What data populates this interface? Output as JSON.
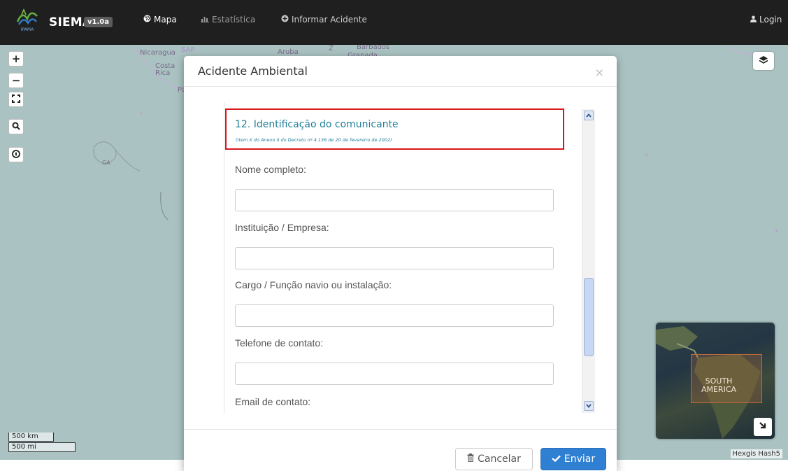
{
  "navbar": {
    "brand_name": "SIEMA",
    "brand_version": "v1.0a",
    "logo_text": "IPAMA",
    "items": [
      {
        "label": "Mapa",
        "icon": "globe-icon"
      },
      {
        "label": "Estatística",
        "icon": "bar-chart-icon"
      },
      {
        "label": "Informar Acidente",
        "icon": "plus-circle-icon"
      }
    ],
    "login_label": "Login",
    "login_icon": "user-icon"
  },
  "map": {
    "labels": {
      "nicaragua": "Nicaragua",
      "sap": "SAP",
      "costa_rica": "Costa\nRica",
      "pa": "Pa",
      "aruba": "Aruba",
      "z": "Z",
      "barbados": "Barbados",
      "granada": "Granada",
      "ga": "GA"
    },
    "controls": [
      "zoom-in",
      "zoom-out",
      "fullscreen",
      "search",
      "locate"
    ],
    "zoom_in": "+",
    "zoom_out": "−",
    "scale": {
      "km": "500 km",
      "mi": "500 mi"
    },
    "minimap": {
      "label": "SOUTH\nAMERICA",
      "toggle_icon": "arrow-down-right-icon"
    },
    "attribution": "Hexgis Hash5"
  },
  "modal": {
    "title": "Acidente Ambiental",
    "close": "×",
    "section": {
      "title": "12. Identificação do comunicante",
      "subtitle": "(Item X do Anexo II do Decreto nº 4.136 de 20 de fevereiro de 2002)"
    },
    "fields": [
      {
        "label": "Nome completo:",
        "value": ""
      },
      {
        "label": "Instituição / Empresa:",
        "value": ""
      },
      {
        "label": "Cargo / Função navio ou instalação:",
        "value": ""
      },
      {
        "label": "Telefone de contato:",
        "value": ""
      },
      {
        "label": "Email de contato:",
        "value": ""
      }
    ],
    "cancel_label": "Cancelar",
    "send_label": "Enviar"
  },
  "colors": {
    "navbar_bg": "#1f1f1f",
    "map_water": "#aac3c2",
    "section_border": "#d9161c",
    "section_text": "#1f7f9a",
    "primary_button": "#2f7fd3"
  }
}
